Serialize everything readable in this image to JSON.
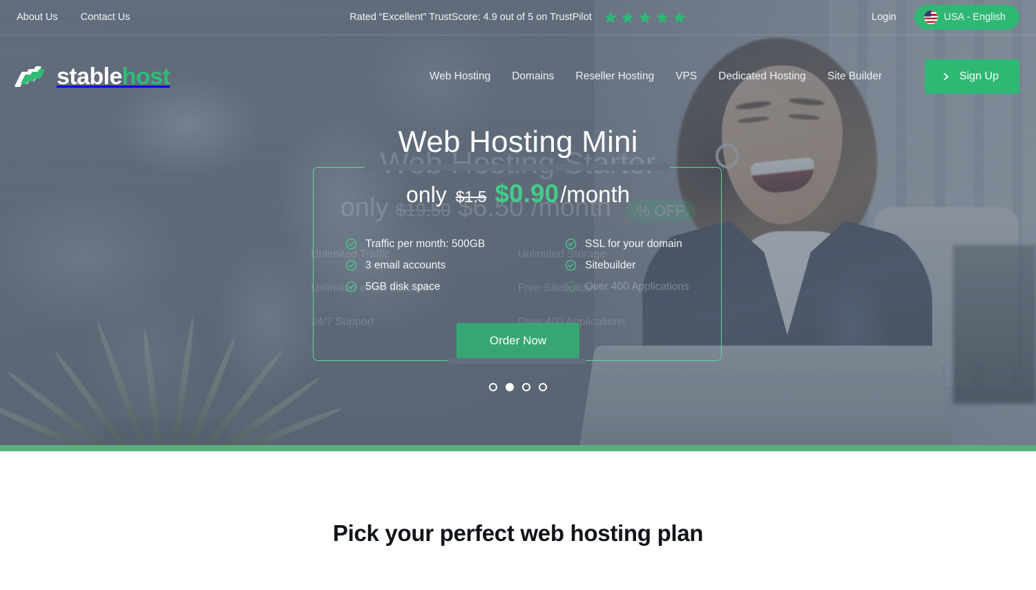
{
  "topbar": {
    "links": [
      {
        "label": "About Us",
        "name": "about-us"
      },
      {
        "label": "Contact Us",
        "name": "contact-us"
      }
    ],
    "trust_text": "Rated “Excellent” TrustScore: 4.9 out of 5 on TrustPilot",
    "star_count": 5,
    "star_color": "#2eb873",
    "login_label": "Login",
    "language_label": "USA - English",
    "flag_icon": "us-flag-icon"
  },
  "brand": {
    "name_part1": "stable",
    "name_part2": "host",
    "accent_color": "#31bb76"
  },
  "nav": {
    "items": [
      {
        "label": "Web Hosting",
        "name": "web-hosting"
      },
      {
        "label": "Domains",
        "name": "domains"
      },
      {
        "label": "Reseller Hosting",
        "name": "reseller-hosting"
      },
      {
        "label": "VPS",
        "name": "vps"
      },
      {
        "label": "Dedicated Hosting",
        "name": "dedicated-hosting"
      },
      {
        "label": "Site Builder",
        "name": "site-builder"
      }
    ],
    "signup_label": "Sign Up",
    "signup_icon": "chevron-right-icon"
  },
  "hero": {
    "previous_slide": {
      "title": "Web Hosting Starter",
      "price_only": "only",
      "price_old": "$19.50",
      "price_new": "$6.50",
      "price_period": "/month",
      "badge": "% OFF",
      "features_left": [
        "Unlimited Traffic",
        "Unlimited email accounts",
        "24/7 Support"
      ],
      "features_right": [
        "Unlimited Storage",
        "Free Sitebuilder",
        "Over 400 Applications"
      ]
    },
    "current_slide": {
      "title": "Web Hosting Mini",
      "price_only": "only",
      "price_old": "$1.5",
      "price_new": "$0.90",
      "price_period": "/month",
      "features": [
        {
          "label": "Traffic per month: 500GB",
          "dim": false
        },
        {
          "label": "SSL for your domain",
          "dim": false
        },
        {
          "label": "3 email accounts",
          "dim": false
        },
        {
          "label": "Sitebuilder",
          "dim": false
        },
        {
          "label": "5GB disk space",
          "dim": false
        },
        {
          "label": "Over 400 Applications",
          "dim": true
        }
      ],
      "cta_label": "Order Now"
    },
    "carousel": {
      "total_dots": 4,
      "active_index": 2
    },
    "accent_color": "#2eb873",
    "frame_color": "#62d79c"
  },
  "plans": {
    "heading": "Pick your perfect web hosting plan"
  }
}
